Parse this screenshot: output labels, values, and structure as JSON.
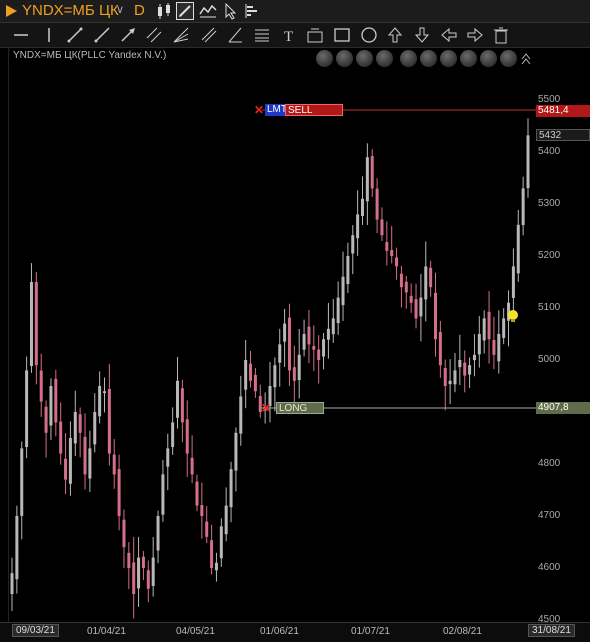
{
  "header": {
    "ticker": "YNDX=МБ ЦК",
    "period": "D"
  },
  "chart_label": "YNDX=МБ ЦК(PLLC Yandex N.V.)",
  "price_axis": {
    "ticks": [
      "5500",
      "5400",
      "5300",
      "5200",
      "5100",
      "5000",
      "4900",
      "4800",
      "4700",
      "4600",
      "4500"
    ],
    "current_price": "5432",
    "sell_order_price": "5481,4",
    "long_position_price": "4907,8"
  },
  "orders": {
    "sell_type": "LMT",
    "sell_label": "SELL",
    "long_label": "LONG"
  },
  "time_axis": {
    "labels": [
      "09/03/21",
      "01/04/21",
      "04/05/21",
      "01/06/21",
      "01/07/21",
      "02/08/21",
      "31/08/21"
    ]
  },
  "colors": {
    "up_candle": "#b8b8b8",
    "down_candle": "#d46f8a",
    "sell_line": "#cc1111",
    "long_line": "#6a7a50",
    "accent": "#f0a020"
  },
  "chart_data": {
    "type": "candlestick",
    "x_range": [
      "09/03/21",
      "31/08/21"
    ],
    "ylim": [
      4500,
      5500
    ],
    "closes": [
      4590,
      4700,
      4830,
      4980,
      5150,
      4990,
      4920,
      4860,
      4950,
      4880,
      4820,
      4770,
      4850,
      4900,
      4860,
      4780,
      4830,
      4900,
      4950,
      4940,
      4820,
      4780,
      4700,
      4640,
      4600,
      4550,
      4620,
      4600,
      4560,
      4620,
      4700,
      4780,
      4830,
      4880,
      4960,
      4880,
      4820,
      4780,
      4720,
      4700,
      4660,
      4600,
      4610,
      4680,
      4720,
      4790,
      4860,
      4930,
      5000,
      4960,
      4940,
      4900,
      4910,
      4950,
      4990,
      5030,
      5070,
      4980,
      4960,
      5010,
      5050,
      5030,
      5020,
      5000,
      5040,
      5060,
      5080,
      5120,
      5160,
      5200,
      5240,
      5280,
      5310,
      5390,
      5330,
      5270,
      5240,
      5210,
      5200,
      5180,
      5140,
      5130,
      5110,
      5080,
      5120,
      5180,
      5140,
      5040,
      4990,
      4950,
      4960,
      4980,
      5000,
      4970,
      4990,
      5010,
      5050,
      5080,
      5040,
      5010,
      5050,
      5080,
      5110,
      5180,
      5260,
      5330,
      5432
    ]
  }
}
